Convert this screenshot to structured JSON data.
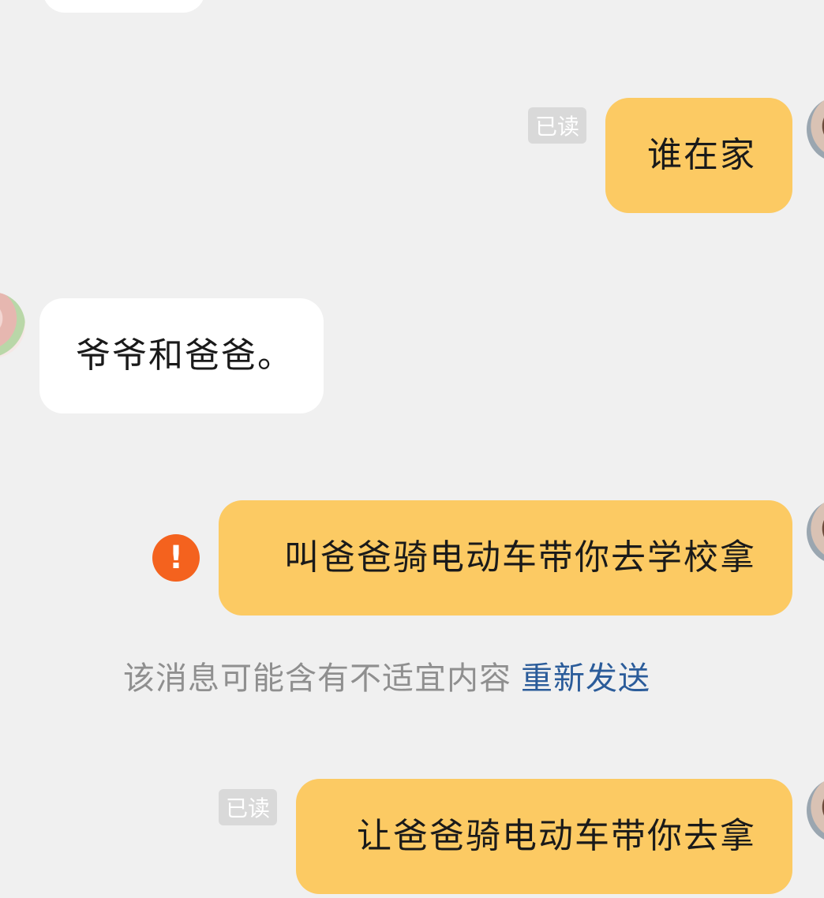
{
  "messages": [
    {
      "id": "m1",
      "direction": "out",
      "text": "谁在家",
      "status": "已读"
    },
    {
      "id": "m2",
      "direction": "in",
      "text": "爷爷和爸爸。"
    },
    {
      "id": "m3",
      "direction": "out",
      "text": "叫爸爸骑电动车带你去学校拿",
      "status_icon": "exclamation-icon",
      "notice": "该消息可能含有不适宜内容",
      "notice_action": "重新发送"
    },
    {
      "id": "m4",
      "direction": "out",
      "text": "让爸爸骑电动车带你去拿",
      "status": "已读"
    }
  ],
  "colors": {
    "background": "#f0f0f0",
    "outgoing_bubble": "#fcca63",
    "incoming_bubble": "#ffffff",
    "error": "#f4621e",
    "link": "#2b5c9a"
  }
}
